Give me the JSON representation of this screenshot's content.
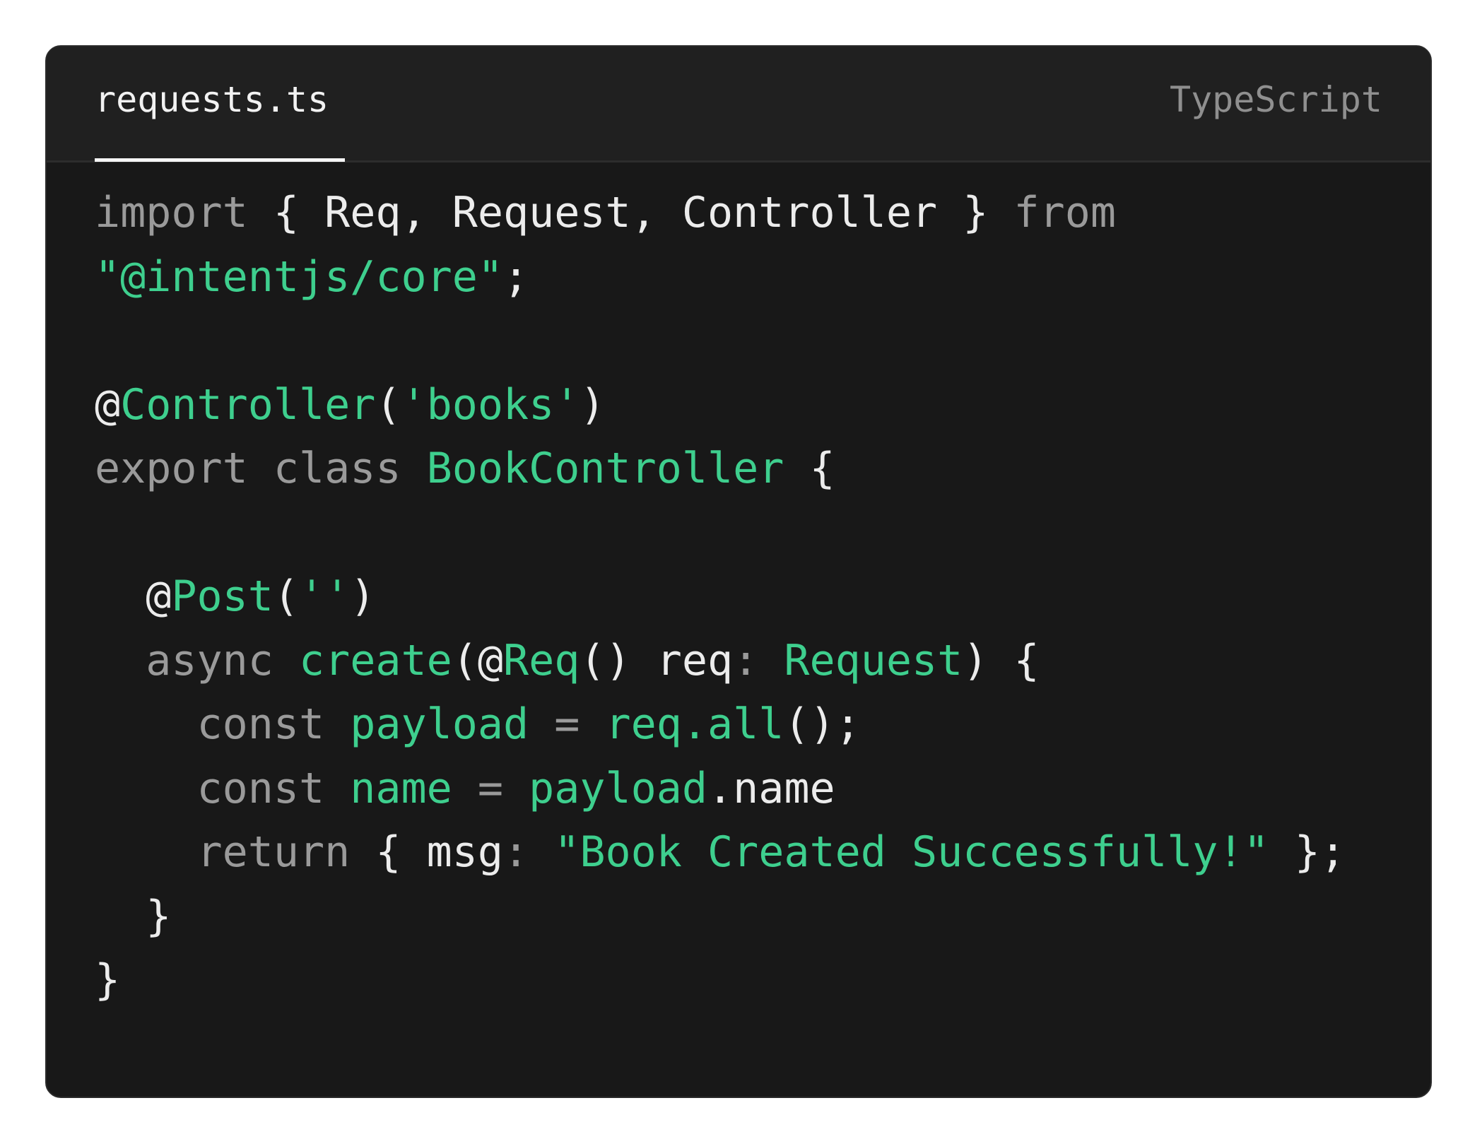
{
  "file_tab": {
    "name": "requests.ts"
  },
  "language_label": "TypeScript",
  "colors": {
    "background": "#181818",
    "header": "#202020",
    "keyword": "#9a9a9a",
    "accent_green": "#3ecf8e",
    "text": "#ececec"
  },
  "code_lines": [
    [
      [
        "kw",
        "import"
      ],
      [
        "wh",
        " { Req, Request, Controller } "
      ],
      [
        "kw",
        "from"
      ]
    ],
    [
      [
        "gr",
        "\"@intentjs/core\""
      ],
      [
        "wh",
        ";"
      ]
    ],
    [],
    [
      [
        "wh",
        "@"
      ],
      [
        "gr",
        "Controller"
      ],
      [
        "wh",
        "("
      ],
      [
        "gr",
        "'books'"
      ],
      [
        "wh",
        ")"
      ]
    ],
    [
      [
        "kw",
        "export class "
      ],
      [
        "gr",
        "BookController"
      ],
      [
        "wh",
        " {"
      ]
    ],
    [],
    [
      [
        "wh",
        "  @"
      ],
      [
        "gr",
        "Post"
      ],
      [
        "wh",
        "("
      ],
      [
        "gr",
        "''"
      ],
      [
        "wh",
        ")"
      ]
    ],
    [
      [
        "kw",
        "  async "
      ],
      [
        "gr",
        "create"
      ],
      [
        "wh",
        "(@"
      ],
      [
        "gr",
        "Req"
      ],
      [
        "wh",
        "() req"
      ],
      [
        "kw",
        ": "
      ],
      [
        "gr",
        "Request"
      ],
      [
        "wh",
        ") {"
      ]
    ],
    [
      [
        "kw",
        "    const "
      ],
      [
        "gr",
        "payload"
      ],
      [
        "kw",
        " = "
      ],
      [
        "gr",
        "req.all"
      ],
      [
        "wh",
        "();"
      ]
    ],
    [
      [
        "kw",
        "    const "
      ],
      [
        "gr",
        "name"
      ],
      [
        "kw",
        " = "
      ],
      [
        "gr",
        "payload"
      ],
      [
        "wh",
        ".name"
      ]
    ],
    [
      [
        "kw",
        "    return"
      ],
      [
        "wh",
        " { msg"
      ],
      [
        "kw",
        ": "
      ],
      [
        "gr",
        "\"Book Created Successfully!\""
      ],
      [
        "wh",
        " };"
      ]
    ],
    [
      [
        "wh",
        "  }"
      ]
    ],
    [
      [
        "wh",
        "}"
      ]
    ]
  ]
}
